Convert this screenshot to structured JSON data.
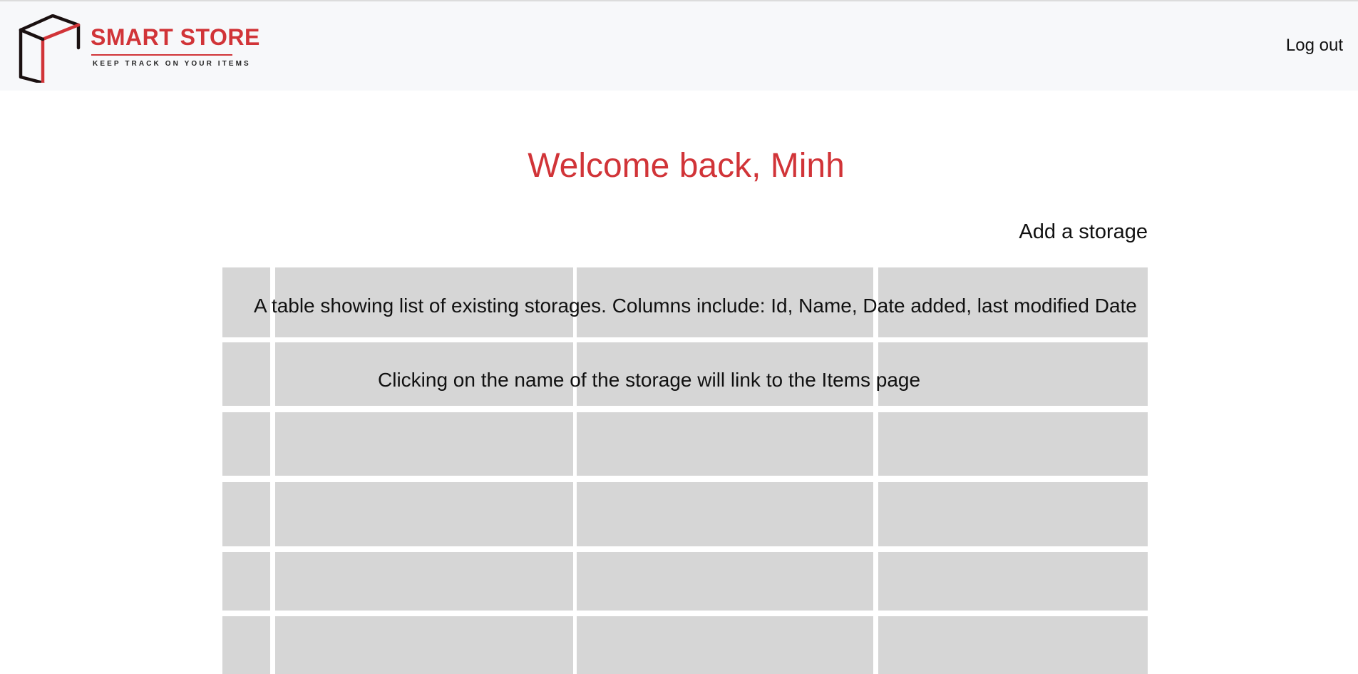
{
  "header": {
    "logo": {
      "title": "SMART STORE",
      "tagline": "KEEP TRACK ON YOUR ITEMS"
    },
    "logout_label": "Log out"
  },
  "main": {
    "welcome": "Welcome back, Minh",
    "add_storage_label": "Add a storage",
    "table_placeholder": {
      "description": "A table showing list of existing storages. Columns include: Id, Name, Date added, last modified Date",
      "note": "Clicking on the name of the storage will link to the Items page",
      "columns": 4,
      "rows": 6
    }
  },
  "colors": {
    "brand": "#d13438",
    "header_bg": "#f7f8fa",
    "cell_bg": "#d6d6d6"
  }
}
